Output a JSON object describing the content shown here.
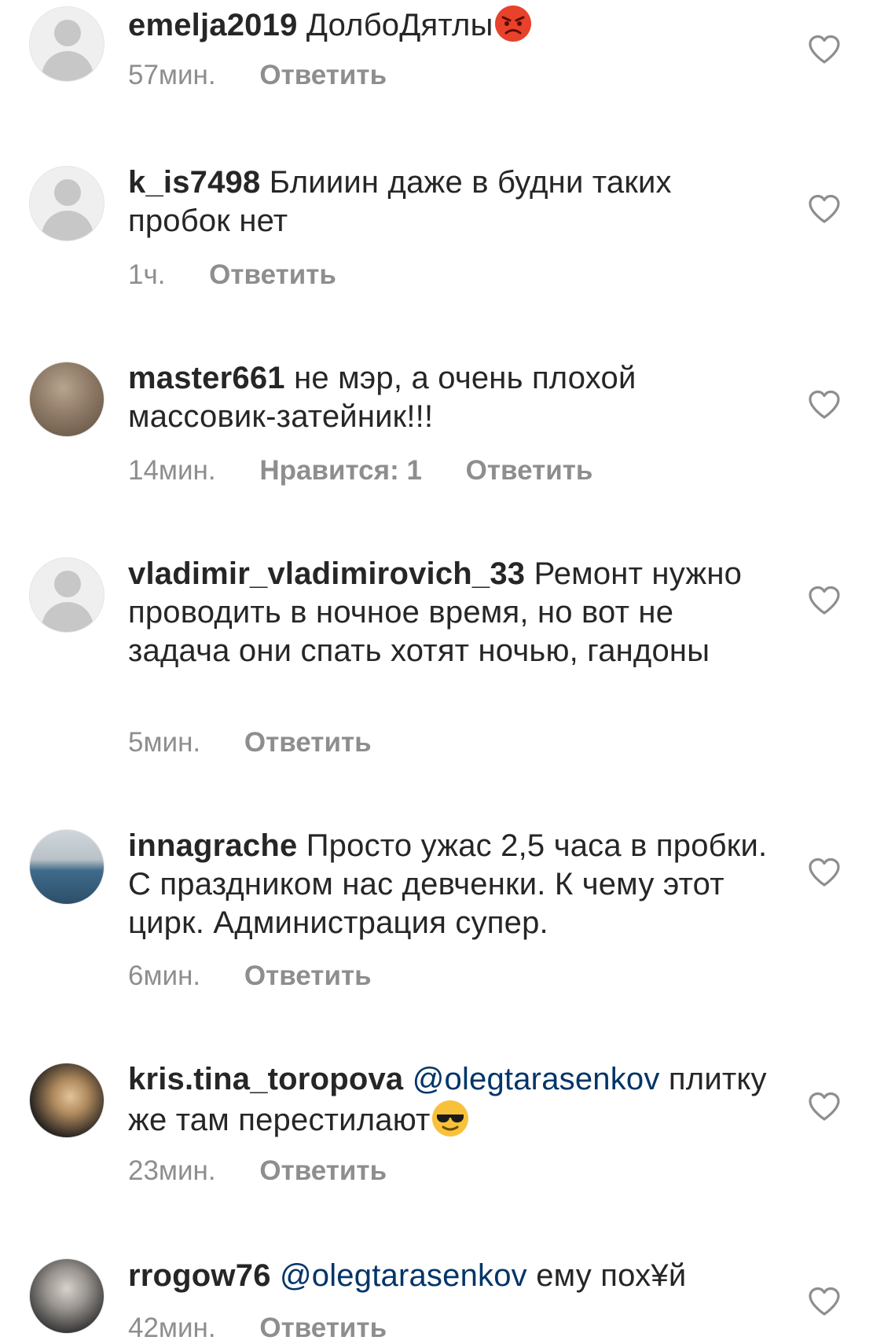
{
  "comments": [
    {
      "username": "emelja2019",
      "text": "ДолбоДятлы",
      "emoji": "angry-face",
      "time": "57мин.",
      "reply": "Ответить"
    },
    {
      "username": "k_is7498",
      "text": "Блииин даже в будни таких пробок нет",
      "time": "1ч.",
      "reply": "Ответить"
    },
    {
      "username": "master661",
      "text": "не мэр, а очень плохой массовик-затейник!!!",
      "time": "14мин.",
      "likes": "Нравится: 1",
      "reply": "Ответить"
    },
    {
      "username": "vladimir_vladimirovich_33",
      "text": "Ремонт нужно проводить в ночное время, но вот не задача они спать хотят ночью, гандоны",
      "time": "5мин.",
      "reply": "Ответить"
    },
    {
      "username": "innagrache",
      "text": "Просто ужас 2,5 часа в пробки. С праздником нас девченки. К чему этот цирк. Администрация супер.",
      "time": "6мин.",
      "reply": "Ответить"
    },
    {
      "username": "kris.tina_toropova",
      "mention": "@olegtarasenkov",
      "text": "плитку же там перестилают",
      "emoji": "sunglasses-face",
      "time": "23мин.",
      "reply": "Ответить"
    },
    {
      "username": "rrogow76",
      "mention": "@olegtarasenkov",
      "text": "ему пох¥й",
      "time": "42мин.",
      "reply": "Ответить"
    }
  ],
  "colors": {
    "text": "#262626",
    "meta": "#8e8e8e",
    "mention": "#003569",
    "heart": "#8e8e8e"
  }
}
